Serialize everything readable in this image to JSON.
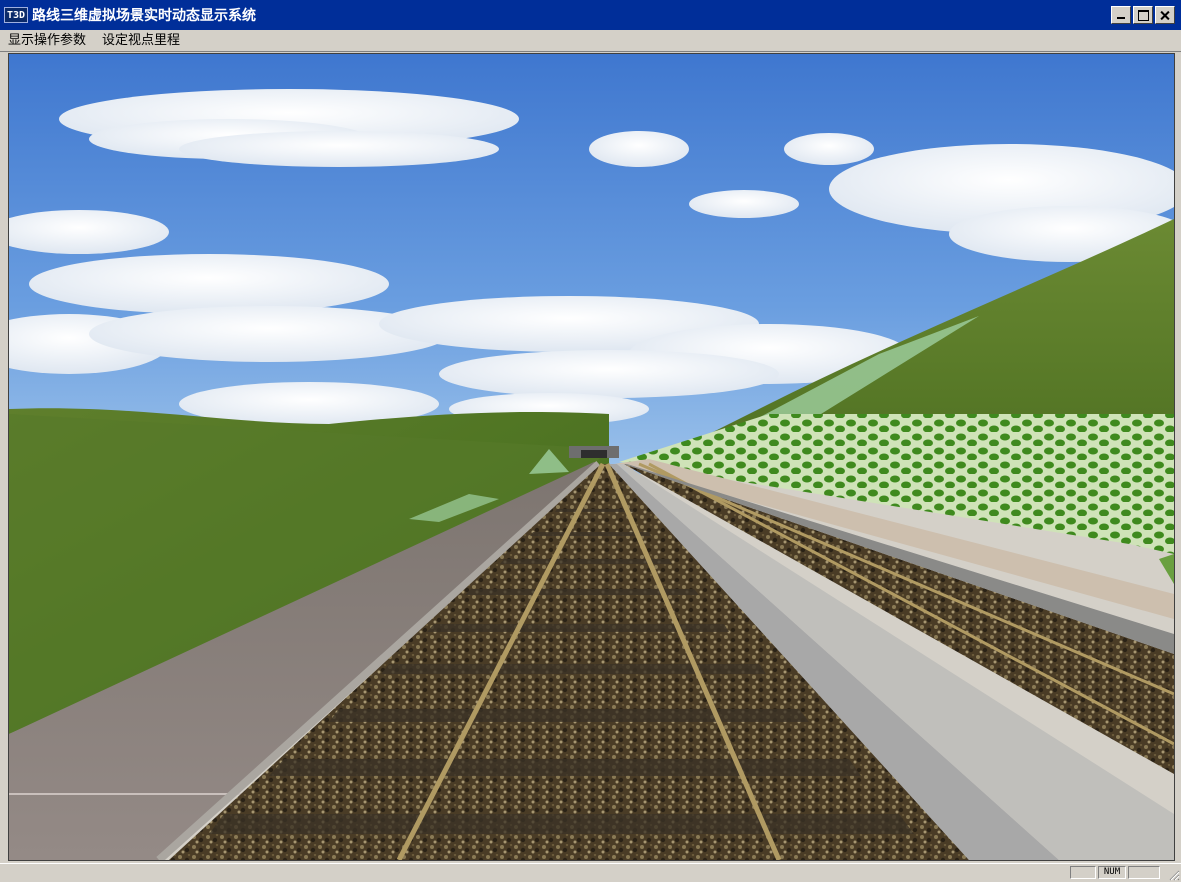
{
  "window": {
    "app_icon_text": "T3D",
    "title": "路线三维虚拟场景实时动态显示系统"
  },
  "menu": {
    "items": [
      {
        "label": "显示操作参数"
      },
      {
        "label": "设定视点里程"
      }
    ]
  },
  "scene": {
    "description_icons": [
      "sky",
      "clouds",
      "grass-hills",
      "railway-track",
      "embankment",
      "tunnel-portal"
    ]
  },
  "status": {
    "num_indicator": "NUM"
  },
  "colors": {
    "titlebar": "#002e99",
    "chrome": "#d4d0c8",
    "sky": "#4f86d3",
    "grass": "#5c7a2a"
  }
}
